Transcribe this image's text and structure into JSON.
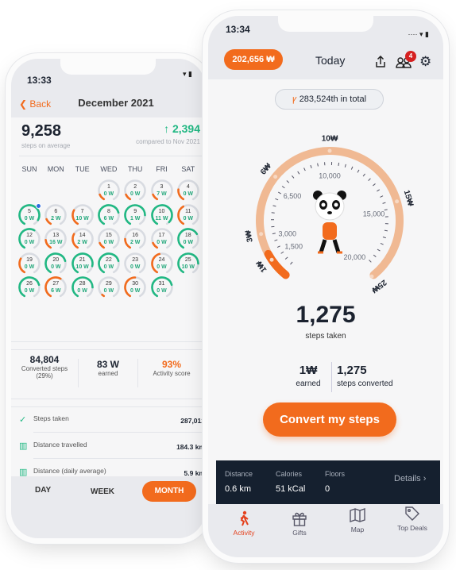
{
  "left_phone": {
    "status_time": "13:33",
    "back_label": "Back",
    "title": "December 2021",
    "avg_steps": "9,258",
    "avg_label": "steps on average",
    "delta": "2,394",
    "delta_label": "compared to Nov 2021",
    "weekdays": [
      "SUN",
      "MON",
      "TUE",
      "WED",
      "THU",
      "FRI",
      "SAT"
    ],
    "first_weekday_index": 3,
    "days": [
      {
        "n": "1",
        "w": "0 W",
        "status": "orange",
        "progress": 0.12
      },
      {
        "n": "2",
        "w": "0 W",
        "status": "orange",
        "progress": 0.12
      },
      {
        "n": "3",
        "w": "7 W",
        "status": "orange",
        "progress": 0.12
      },
      {
        "n": "4",
        "w": "0 W",
        "status": "orange",
        "progress": 0.22
      },
      {
        "n": "5",
        "w": "0 W",
        "status": "green",
        "progress": 0.9,
        "badge": true
      },
      {
        "n": "6",
        "w": "2 W",
        "status": "orange",
        "progress": 0.12
      },
      {
        "n": "7",
        "w": "10 W",
        "status": "orange",
        "progress": 0.3
      },
      {
        "n": "8",
        "w": "6 W",
        "status": "green",
        "progress": 0.75
      },
      {
        "n": "9",
        "w": "1 W",
        "status": "green",
        "progress": 0.8
      },
      {
        "n": "10",
        "w": "11 W",
        "status": "green",
        "progress": 0.95
      },
      {
        "n": "11",
        "w": "0 W",
        "status": "orange",
        "progress": 0.4
      },
      {
        "n": "12",
        "w": "0 W",
        "status": "green",
        "progress": 0.6
      },
      {
        "n": "13",
        "w": "16 W",
        "status": "orange",
        "progress": 0.18
      },
      {
        "n": "14",
        "w": "2 W",
        "status": "orange",
        "progress": 0.3
      },
      {
        "n": "15",
        "w": "0 W",
        "status": "orange",
        "progress": 0.12
      },
      {
        "n": "16",
        "w": "2 W",
        "status": "orange",
        "progress": 0.2
      },
      {
        "n": "17",
        "w": "0 W",
        "status": "orange",
        "progress": 0.12
      },
      {
        "n": "18",
        "w": "0 W",
        "status": "green",
        "progress": 0.7
      },
      {
        "n": "19",
        "w": "0 W",
        "status": "orange",
        "progress": 0.3
      },
      {
        "n": "20",
        "w": "0 W",
        "status": "green",
        "progress": 0.75
      },
      {
        "n": "21",
        "w": "10 W",
        "status": "green",
        "progress": 0.85
      },
      {
        "n": "22",
        "w": "0 W",
        "status": "green",
        "progress": 0.75
      },
      {
        "n": "23",
        "w": "0 W",
        "status": "none",
        "progress": 0
      },
      {
        "n": "24",
        "w": "0 W",
        "status": "orange",
        "progress": 0.45
      },
      {
        "n": "25",
        "w": "10 W",
        "status": "green",
        "progress": 0.8
      },
      {
        "n": "26",
        "w": "0 W",
        "status": "green",
        "progress": 0.75
      },
      {
        "n": "27",
        "w": "6 W",
        "status": "orange",
        "progress": 0.6
      },
      {
        "n": "28",
        "w": "0 W",
        "status": "green",
        "progress": 0.8
      },
      {
        "n": "29",
        "w": "0 W",
        "status": "orange",
        "progress": 0.04
      },
      {
        "n": "30",
        "w": "0 W",
        "status": "orange",
        "progress": 0.5
      },
      {
        "n": "31",
        "w": "0 W",
        "status": "green",
        "progress": 0.75
      }
    ],
    "summary": [
      {
        "value": "84,804",
        "label": "Converted steps",
        "note": "(29%)"
      },
      {
        "value": "83 W",
        "label": "earned"
      },
      {
        "value": "93%",
        "label": "Activity score"
      }
    ],
    "stats": [
      {
        "icon": "check-circle-icon",
        "label": "Steps taken",
        "value": "287,012"
      },
      {
        "icon": "map-icon",
        "label": "Distance travelled",
        "value": "184.3 km"
      },
      {
        "icon": "map-average-icon",
        "label": "Distance (daily average)",
        "value": "5.9 km"
      }
    ],
    "periods": [
      "DAY",
      "WEEK",
      "MONTH"
    ],
    "active_period": "MONTH"
  },
  "right_phone": {
    "status_time": "13:34",
    "balance": "202,656 ₩",
    "title": "Today",
    "notification_count": "4",
    "rank": "283,524th in total",
    "gauge": {
      "reward_labels": [
        "1₩",
        "3₩",
        "6₩",
        "10₩",
        "15₩",
        "25₩"
      ],
      "step_labels": [
        "1,500",
        "3,000",
        "6,500",
        "10,000",
        "15,000",
        "20,000"
      ],
      "progress": 0.08
    },
    "steps": "1,275",
    "steps_label": "steps taken",
    "earned_value": "1₩",
    "earned_label": "earned",
    "converted_value": "1,275",
    "converted_label": "steps converted",
    "convert_button": "Convert my steps",
    "metrics": [
      {
        "label": "Distance",
        "value": "0.6 km"
      },
      {
        "label": "Calories",
        "value": "51 kCal"
      },
      {
        "label": "Floors",
        "value": "0"
      }
    ],
    "details_label": "Details",
    "tabs": [
      {
        "label": "Activity",
        "icon": "walking-icon",
        "active": true
      },
      {
        "label": "Gifts",
        "icon": "gift-icon"
      },
      {
        "label": "Map",
        "icon": "map-icon"
      },
      {
        "label": "Top Deals",
        "icon": "tag-icon"
      }
    ]
  },
  "colors": {
    "accent": "#f26b1d",
    "green": "#21b883",
    "gauge_track": "#f0b993",
    "dark_bar": "#15202f"
  }
}
